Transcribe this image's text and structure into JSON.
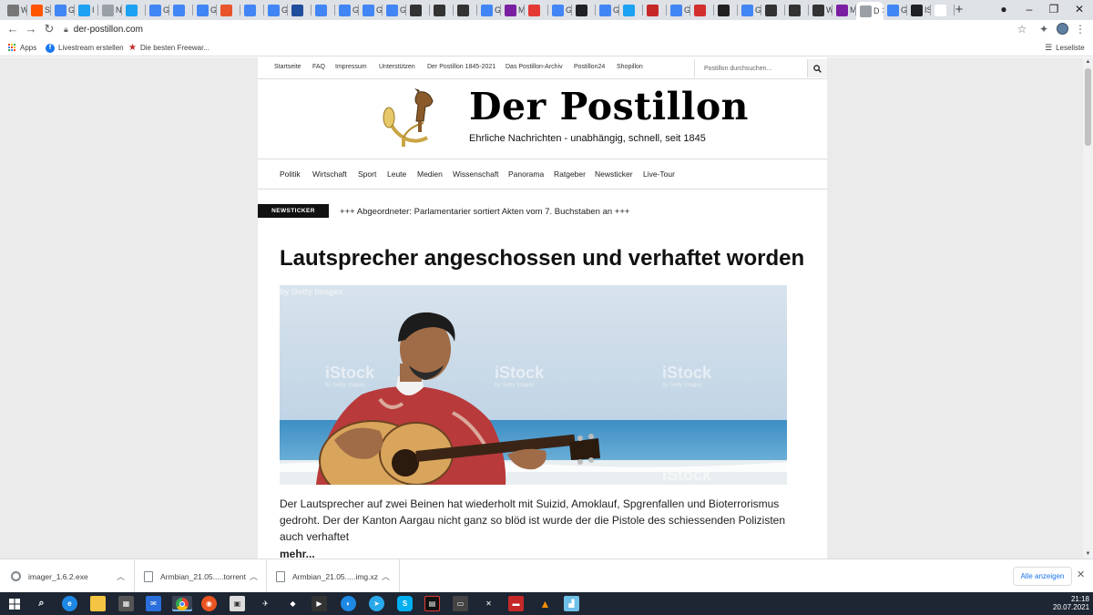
{
  "browser": {
    "tabs": [
      {
        "icon": "wikipedia-icon",
        "color": "#777777",
        "label": "W"
      },
      {
        "icon": "soundcloud-icon",
        "color": "#ff5500",
        "label": "S"
      },
      {
        "icon": "google-icon",
        "color": "#4285f4",
        "label": "G I"
      },
      {
        "icon": "twitter-icon",
        "color": "#1da1f2",
        "label": "I"
      },
      {
        "icon": "new-tab-icon",
        "color": "#9aa0a6",
        "label": "Neu"
      },
      {
        "icon": "twitter-icon",
        "color": "#1da1f2",
        "label": ""
      },
      {
        "icon": "google-icon",
        "color": "#4285f4",
        "label": "G"
      },
      {
        "icon": "google-translate-icon",
        "color": "#4285f4",
        "label": ""
      },
      {
        "icon": "google-icon",
        "color": "#4285f4",
        "label": "G"
      },
      {
        "icon": "orange-app-icon",
        "color": "#e8542c",
        "label": ""
      },
      {
        "icon": "google-translate-icon",
        "color": "#4285f4",
        "label": ""
      },
      {
        "icon": "google-icon",
        "color": "#4285f4",
        "label": "G"
      },
      {
        "icon": "db-icon",
        "color": "#1f4e9c",
        "label": ""
      },
      {
        "icon": "google-translate-icon",
        "color": "#4285f4",
        "label": ""
      },
      {
        "icon": "google-icon",
        "color": "#4285f4",
        "label": "G"
      },
      {
        "icon": "google-icon",
        "color": "#4285f4",
        "label": "G"
      },
      {
        "icon": "google-icon",
        "color": "#4285f4",
        "label": "G"
      },
      {
        "icon": "qr-icon",
        "color": "#333333",
        "label": ""
      },
      {
        "icon": "github-icon",
        "color": "#333333",
        "label": ""
      },
      {
        "icon": "github-icon",
        "color": "#333333",
        "label": ""
      },
      {
        "icon": "google-icon",
        "color": "#4285f4",
        "label": "G"
      },
      {
        "icon": "m-icon",
        "color": "#7b1fa2",
        "label": "M"
      },
      {
        "icon": "red-bar-icon",
        "color": "#e53935",
        "label": ""
      },
      {
        "icon": "google-icon",
        "color": "#4285f4",
        "label": "G"
      },
      {
        "icon": "translate-icon",
        "color": "#202124",
        "label": ""
      },
      {
        "icon": "google-icon",
        "color": "#4285f4",
        "label": "G"
      },
      {
        "icon": "twitter-icon",
        "color": "#1da1f2",
        "label": ""
      },
      {
        "icon": "brand-b-icon",
        "color": "#c62828",
        "label": ""
      },
      {
        "icon": "google-icon",
        "color": "#4285f4",
        "label": "G"
      },
      {
        "icon": "opera-icon",
        "color": "#d32f2f",
        "label": ""
      },
      {
        "icon": "dark-app-icon",
        "color": "#212121",
        "label": ""
      },
      {
        "icon": "google-icon",
        "color": "#4285f4",
        "label": "G"
      },
      {
        "icon": "github-icon",
        "color": "#333333",
        "label": ""
      },
      {
        "icon": "github-icon",
        "color": "#333333",
        "label": ""
      },
      {
        "icon": "wikipedia-icon",
        "color": "#333333",
        "label": "W"
      },
      {
        "icon": "m-icon",
        "color": "#7b1fa2",
        "label": "M"
      },
      {
        "icon": "postillon-icon",
        "color": "#9aa0a6",
        "label": "D",
        "active": true
      },
      {
        "icon": "google-icon",
        "color": "#4285f4",
        "label": "G"
      },
      {
        "icon": "is-icon",
        "color": "#202124",
        "label": "IS"
      },
      {
        "icon": "blank-icon",
        "color": "#ffffff",
        "label": ""
      }
    ],
    "url": "der-postillon.com",
    "bookmarks": [
      {
        "label": "Apps",
        "icon": "apps-grid-icon"
      },
      {
        "label": "Livestream erstellen",
        "icon": "facebook-icon"
      },
      {
        "label": "Die besten Freewar...",
        "icon": "star-icon"
      }
    ],
    "reading_list": "Leseliste"
  },
  "site": {
    "topnav": [
      "Startseite",
      "FAQ",
      "Impressum",
      "Unterstützen",
      "Der Postillon 1845-2021",
      "Das Postillon-Archiv",
      "Postillon24",
      "Shopillon"
    ],
    "search_placeholder": "Postillon durchsuchen...",
    "logo_title": "Der Postillon",
    "tagline": "Ehrliche Nachrichten - unabhängig, schnell, seit 1845",
    "categories": [
      "Politik",
      "Wirtschaft",
      "Sport",
      "Leute",
      "Medien",
      "Wissenschaft",
      "Panorama",
      "Ratgeber",
      "Newsticker",
      "Live-Tour"
    ],
    "ticker_label": "NEWSTICKER",
    "ticker_text": "+++ Abgeordneter: Parlamentarier sortiert Akten vom 7. Buchstaben an +++",
    "article": {
      "headline": "Lautsprecher angeschossen und verhaftet worden",
      "image_watermark": "iStock",
      "image_watermark_sub": "by Getty Images",
      "teaser": "Der Lautsprecher auf zwei Beinen hat wiederholt mit Suizid, Amoklauf, Spgrenfallen und Bioterrorismus gedroht. Der der Kanton Aargau nicht ganz so blöd ist wurde der die Pistole des schiessenden Polizisten auch verhaftet",
      "more": "mehr..."
    }
  },
  "downloads": {
    "items": [
      {
        "name": "imager_1.6.2.exe"
      },
      {
        "name": "Armbian_21.05.....torrent"
      },
      {
        "name": "Armbian_21.05.....img.xz"
      }
    ],
    "show_all": "Alle anzeigen"
  },
  "taskbar": {
    "time": "21:18",
    "date": "20.07.2021"
  }
}
